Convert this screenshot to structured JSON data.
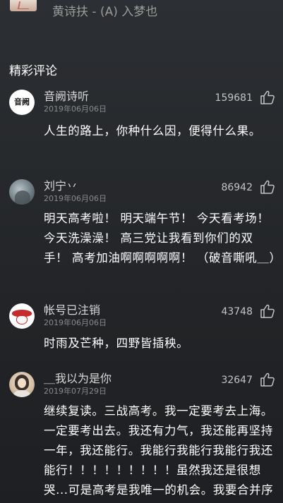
{
  "header": {
    "song_title": "黄诗扶 - (A) 入梦也"
  },
  "section": {
    "title": "精彩评论"
  },
  "comments": [
    {
      "username": "音阙诗听",
      "date": "2019年06月06日",
      "likes": "159681",
      "text": "人生的路上，你种什么因，便得什么果。",
      "avatar_glyph": "音阙"
    },
    {
      "username": "刘宁丷",
      "date": "2019年06月06日",
      "likes": "86942",
      "text": "明天高考啦！ 明天端午节！ 今天看考场！ 今天洗澡澡！ 高三党让我看到你们的双手！ 高考加油啊啊啊啊啊！ （破音嘶吼＿）"
    },
    {
      "username": "帐号已注销",
      "date": "2019年06月06日",
      "likes": "43748",
      "text": "时雨及芒种，四野皆插秧。"
    },
    {
      "username": "＿我以为是你",
      "date": "2019年07月29日",
      "likes": "32647",
      "text": "继续复读。三战高考。我一定要考去上海。一定要考出去。我还有力气，我还能再坚持一年，我还能行。我能行我能行我能行我还能行！！！！！！！！！虽然我还是很想哭...可是高考是我唯一的机会。我要合并序曲，我要去上海"
    }
  ],
  "icons": {
    "like": "thumbs-up-icon"
  }
}
